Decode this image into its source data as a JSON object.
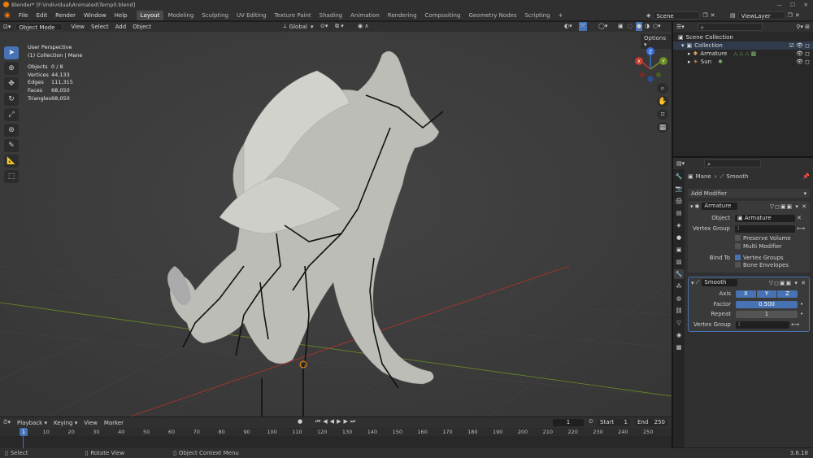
{
  "title_bar": {
    "text": "Blender* [F:\\Individual\\Animated\\Temp0.blend]"
  },
  "menu": {
    "items": [
      "File",
      "Edit",
      "Render",
      "Window",
      "Help"
    ]
  },
  "workspaces": [
    "Layout",
    "Modeling",
    "Sculpting",
    "UV Editing",
    "Texture Paint",
    "Shading",
    "Animation",
    "Rendering",
    "Compositing",
    "Geometry Nodes",
    "Scripting",
    "+"
  ],
  "scene": {
    "label": "Scene",
    "view_layer": "ViewLayer"
  },
  "viewport": {
    "mode": "Object Mode",
    "menus": [
      "View",
      "Select",
      "Add",
      "Object"
    ],
    "transform_orientation": "Global",
    "options_label": "Options",
    "overlay_title": "User Perspective",
    "overlay_subtitle": "(1) Collection | Mane",
    "stats": [
      {
        "label": "Objects",
        "value": "0 / 8"
      },
      {
        "label": "Vertices",
        "value": "44,133"
      },
      {
        "label": "Edges",
        "value": "111,315"
      },
      {
        "label": "Faces",
        "value": "68,050"
      },
      {
        "label": "Triangles",
        "value": "68,050"
      }
    ],
    "gizmo_axes": [
      "Z",
      "Y",
      "X"
    ]
  },
  "outliner": {
    "scene_collection": "Scene Collection",
    "collection": "Collection",
    "items": [
      {
        "name": "Armature"
      },
      {
        "name": "Sun"
      }
    ]
  },
  "properties": {
    "breadcrumb_object": "Mane",
    "breadcrumb_modifier": "Smooth",
    "add_modifier": "Add Modifier",
    "armature_mod": {
      "name": "Armature",
      "object_label": "Object",
      "object_value": "Armature",
      "vertex_group_label": "Vertex Group",
      "preserve_volume": "Preserve Volume",
      "multi_modifier": "Multi Modifier",
      "bind_to_label": "Bind To",
      "vertex_groups": "Vertex Groups",
      "bone_envelopes": "Bone Envelopes"
    },
    "smooth_mod": {
      "name": "Smooth",
      "axis_label": "Axis",
      "axes": [
        "X",
        "Y",
        "Z"
      ],
      "factor_label": "Factor",
      "factor_value": "0.500",
      "repeat_label": "Repeat",
      "repeat_value": "1",
      "vertex_group_label": "Vertex Group"
    }
  },
  "timeline": {
    "menus": [
      "Playback",
      "Keying",
      "View",
      "Marker"
    ],
    "current_frame": "1",
    "start_label": "Start",
    "start_value": "1",
    "end_label": "End",
    "end_value": "250",
    "ticks": [
      "1",
      "10",
      "20",
      "30",
      "40",
      "50",
      "60",
      "70",
      "80",
      "90",
      "100",
      "110",
      "120",
      "130",
      "140",
      "150",
      "160",
      "170",
      "180",
      "190",
      "200",
      "210",
      "220",
      "230",
      "240",
      "250"
    ]
  },
  "status_bar": {
    "select": "Select",
    "rotate": "Rotate View",
    "context": "Object Context Menu",
    "version": "3.6.18"
  },
  "colors": {
    "accent": "#4772b3",
    "orange": "#e87d0d",
    "x_axis": "#c0392b",
    "y_axis": "#6b8e23",
    "z_axis": "#3b6fd6"
  }
}
